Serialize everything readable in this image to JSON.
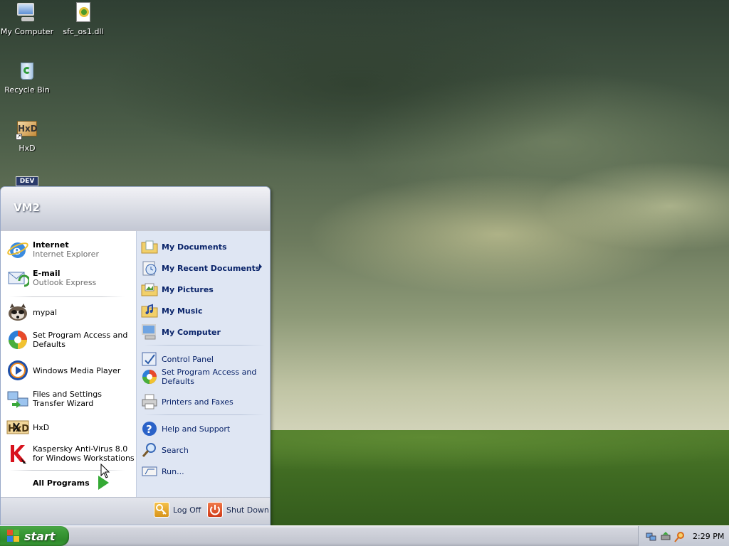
{
  "desktop": {
    "icons": [
      {
        "label": "My Computer",
        "icon": "my-computer-icon"
      },
      {
        "label": "sfc_os1.dll",
        "icon": "dll-file-icon"
      },
      {
        "label": "Recycle Bin",
        "icon": "recycle-bin-icon"
      },
      {
        "label": "HxD",
        "icon": "hxd-shortcut-icon"
      }
    ],
    "partial_icon_text": "DEV"
  },
  "start_menu": {
    "user": "VM2",
    "pinned": [
      {
        "title": "Internet",
        "subtitle": "Internet Explorer",
        "icon": "internet-explorer-icon"
      },
      {
        "title": "E-mail",
        "subtitle": "Outlook Express",
        "icon": "outlook-express-icon"
      }
    ],
    "recent": [
      {
        "label": "mypal",
        "icon": "mypal-raccoon-icon"
      },
      {
        "label": "Set Program Access and Defaults",
        "icon": "program-defaults-icon"
      },
      {
        "label": "Windows Media Player",
        "icon": "media-player-icon"
      },
      {
        "label": "Files and Settings Transfer Wizard",
        "icon": "transfer-wizard-icon"
      },
      {
        "label": "HxD",
        "icon": "hxd-icon"
      },
      {
        "label": "Kaspersky Anti-Virus 8.0 for Windows Workstations",
        "icon": "kaspersky-icon"
      }
    ],
    "all_programs": "All Programs",
    "places": [
      {
        "label": "My Documents",
        "icon": "folder-documents-icon"
      },
      {
        "label": "My Recent Documents",
        "icon": "recent-documents-icon"
      },
      {
        "label": "My Pictures",
        "icon": "folder-pictures-icon"
      },
      {
        "label": "My Music",
        "icon": "folder-music-icon"
      },
      {
        "label": "My Computer",
        "icon": "my-computer-icon"
      }
    ],
    "settings": [
      {
        "label": "Control Panel",
        "icon": "control-panel-icon"
      },
      {
        "label": "Set Program Access and Defaults",
        "icon": "program-defaults-icon"
      },
      {
        "label": "Printers and Faxes",
        "icon": "printer-icon"
      }
    ],
    "help": [
      {
        "label": "Help and Support",
        "icon": "help-icon"
      },
      {
        "label": "Search",
        "icon": "search-icon"
      },
      {
        "label": "Run...",
        "icon": "run-icon"
      }
    ],
    "log_off": "Log Off",
    "shut_down": "Shut Down"
  },
  "taskbar": {
    "start_label": "start",
    "clock": "2:29 PM",
    "tray_icons": [
      "network-icon",
      "safely-remove-icon",
      "search-tray-icon"
    ]
  },
  "colors": {
    "start_green": "#3b9a37",
    "places_blue": "#0a246a",
    "right_pane_bg": "#dfe6f3"
  }
}
